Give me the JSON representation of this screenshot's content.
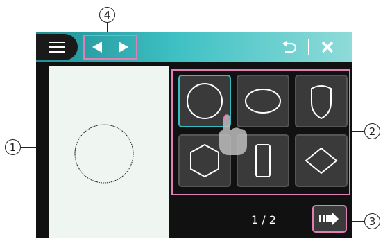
{
  "callouts": {
    "c1": "1",
    "c2": "2",
    "c3": "3",
    "c4": "4"
  },
  "toolbar": {
    "menu_icon": "hamburger-menu-icon",
    "prev_icon": "arrow-left-icon",
    "next_icon": "arrow-right-icon",
    "undo_icon": "undo-icon",
    "close_icon": "close-icon"
  },
  "shapes": [
    {
      "name": "circle",
      "selected": true
    },
    {
      "name": "ellipse",
      "selected": false
    },
    {
      "name": "shield",
      "selected": false
    },
    {
      "name": "hexagon",
      "selected": false
    },
    {
      "name": "rounded-rectangle",
      "selected": false
    },
    {
      "name": "diamond",
      "selected": false
    }
  ],
  "pagination": {
    "text": "1 / 2"
  },
  "colors": {
    "accent_teal": "#35bcc0",
    "highlight_pink": "#e07fb6",
    "panel_dark": "#111111",
    "tile_bg": "#3a3a3a",
    "preview_bg": "#eff6f2"
  }
}
